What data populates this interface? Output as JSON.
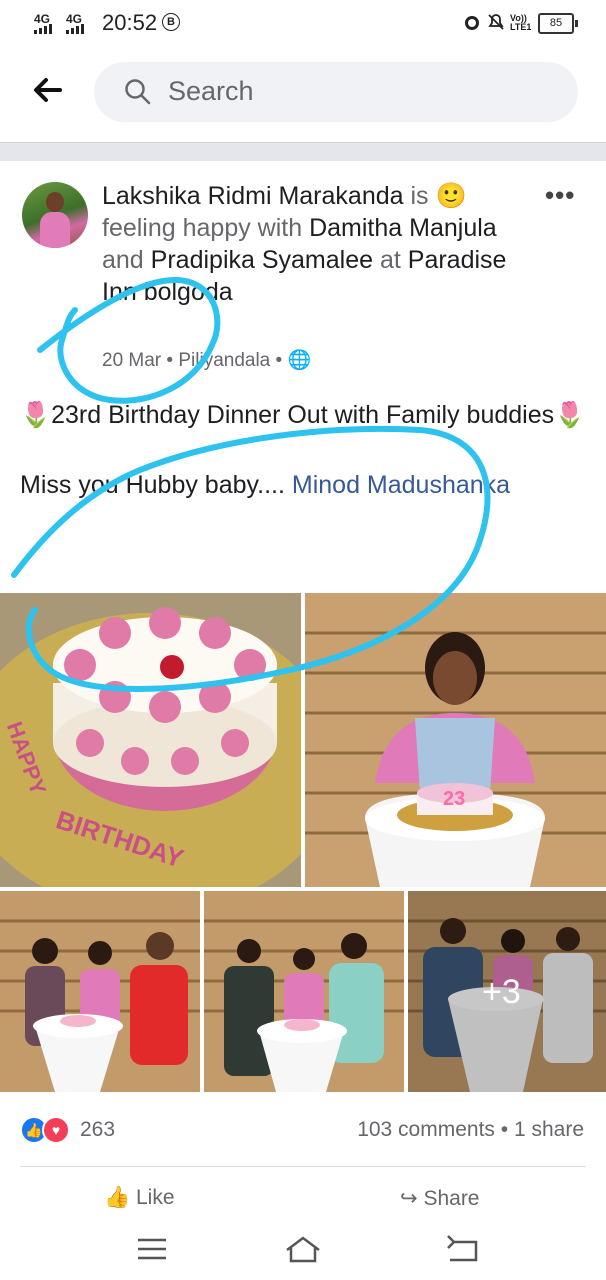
{
  "status_bar": {
    "sig1": "4G",
    "sig2": "4G",
    "time": "20:52",
    "b_icon": "B",
    "volte": "Vo)) LTE1",
    "battery": "85"
  },
  "search": {
    "placeholder": "Search"
  },
  "post": {
    "author": "Lakshika Ridmi Marakanda",
    "is": "is",
    "feeling": "feeling happy with",
    "friend1": "Damitha Manjula",
    "and": "and",
    "friend2": "Pradipika Syamalee",
    "at": "at",
    "place": "Paradise Inn bolgoda",
    "date": "20 Mar",
    "location": "Piliyandala",
    "text_line1": "🌷23rd Birthday Dinner Out with Family buddies🌷",
    "text_line2": "Miss you Hubby baby....",
    "tagged": "Minod Madushanka",
    "cake_text1": "HAPPY",
    "cake_text2": "BIRTHDAY",
    "candle": "23",
    "more_photos": "+3"
  },
  "reactions": {
    "count": "263",
    "comments": "103 comments",
    "shares": "1 share"
  },
  "actions": {
    "like": "Like",
    "share": "Share"
  },
  "colors": {
    "accent": "#1877f2",
    "link": "#385898",
    "annotation": "#2ec2ef"
  }
}
